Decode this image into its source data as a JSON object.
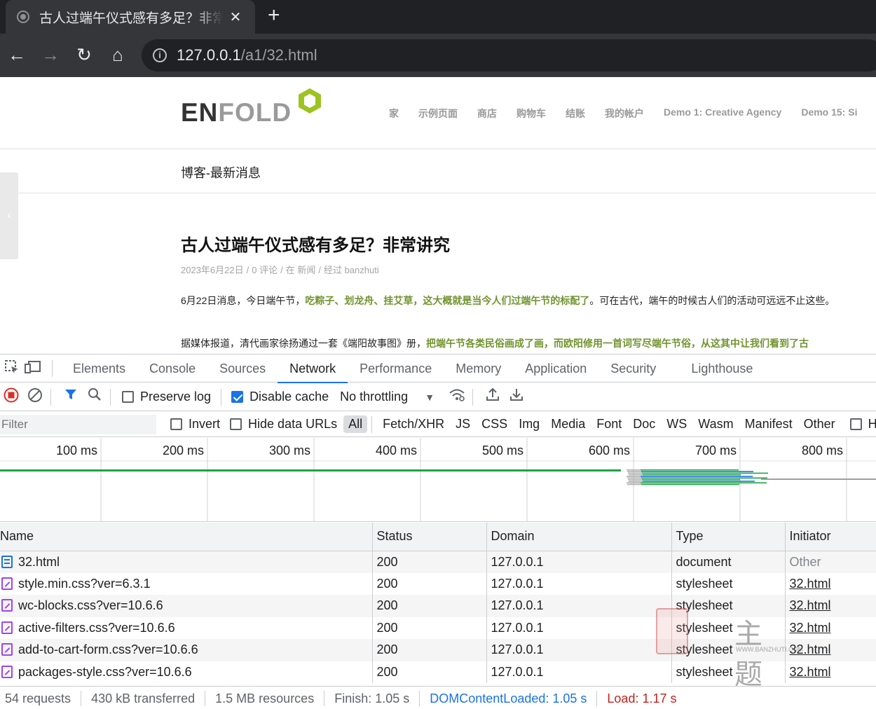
{
  "browser": {
    "tab_title": "古人过端午仪式感有多足？非常讲",
    "tab_close": "✕",
    "new_tab": "+",
    "url_host": "127.0.0.1",
    "url_path": "/a1/32.html",
    "nav": {
      "back": "←",
      "forward": "→",
      "reload": "↻",
      "home": "⌂",
      "info": "i"
    }
  },
  "site": {
    "logo_en": "EN",
    "logo_fold": "FOLD",
    "nav_items": [
      "家",
      "示例页面",
      "商店",
      "购物车",
      "结账",
      "我的帐户",
      "Demo 1: Creative Agency",
      "Demo 15: Si"
    ],
    "crumb_title": "博客-最新消息",
    "side_tab_arrow": "‹",
    "post": {
      "title": "古人过端午仪式感有多足？非常讲究",
      "meta": [
        "2023年6月22日",
        "0 评论",
        "在 新闻",
        "经过 banzhuti"
      ],
      "meta_sep": "/",
      "p1_a": "6月22日消息，今日端午节，",
      "p1_hl": "吃粽子、划龙舟、挂艾草，这大概就是当今人们过端午节的标配了",
      "p1_b": "。可在古代，端午的时候古人们的活动可远远不止这些。",
      "p2_a": "据媒体报道，清代画家徐扬通过一套《端阳故事图》册，",
      "p2_hl": "把端午节各类民俗画成了画，而欧阳修用一首词写尽端午节俗，从这其中让我们看到了古"
    }
  },
  "devtools": {
    "panel_tabs": [
      "Elements",
      "Console",
      "Sources",
      "Network",
      "Performance",
      "Memory",
      "Application",
      "Security",
      "Lighthouse"
    ],
    "active_tab": "Network",
    "toolbar": {
      "preserve_log": "Preserve log",
      "preserve_log_checked": false,
      "disable_cache": "Disable cache",
      "disable_cache_checked": true,
      "throttling": "No throttling"
    },
    "filter": {
      "placeholder": "Filter",
      "invert": "Invert",
      "hide_data_urls": "Hide data URLs",
      "types": [
        "All",
        "Fetch/XHR",
        "JS",
        "CSS",
        "Img",
        "Media",
        "Font",
        "Doc",
        "WS",
        "Wasm",
        "Manifest",
        "Other"
      ],
      "active_type": "All",
      "has_blocked": "Has"
    },
    "timeline_ticks": [
      "100 ms",
      "200 ms",
      "300 ms",
      "400 ms",
      "500 ms",
      "600 ms",
      "700 ms",
      "800 ms"
    ],
    "columns": [
      "Name",
      "Status",
      "Domain",
      "Type",
      "Initiator"
    ],
    "requests": [
      {
        "name": "32.html",
        "status": "200",
        "domain": "127.0.0.1",
        "type": "document",
        "initiator": "Other",
        "kind": "doc"
      },
      {
        "name": "style.min.css?ver=6.3.1",
        "status": "200",
        "domain": "127.0.0.1",
        "type": "stylesheet",
        "initiator": "32.html",
        "kind": "css"
      },
      {
        "name": "wc-blocks.css?ver=10.6.6",
        "status": "200",
        "domain": "127.0.0.1",
        "type": "stylesheet",
        "initiator": "32.html",
        "kind": "css"
      },
      {
        "name": "active-filters.css?ver=10.6.6",
        "status": "200",
        "domain": "127.0.0.1",
        "type": "stylesheet",
        "initiator": "32.html",
        "kind": "css"
      },
      {
        "name": "add-to-cart-form.css?ver=10.6.6",
        "status": "200",
        "domain": "127.0.0.1",
        "type": "stylesheet",
        "initiator": "32.html",
        "kind": "css"
      },
      {
        "name": "packages-style.css?ver=10.6.6",
        "status": "200",
        "domain": "127.0.0.1",
        "type": "stylesheet",
        "initiator": "32.html",
        "kind": "css"
      }
    ],
    "summary": {
      "requests": "54 requests",
      "transferred": "430 kB transferred",
      "resources": "1.5 MB resources",
      "finish": "Finish: 1.05 s",
      "dom_content_loaded": "DOMContentLoaded: 1.05 s",
      "load": "Load: 1.17 s"
    }
  },
  "watermark": {
    "chars": "主题",
    "url": "WWW.BANZHUTI.COM"
  },
  "colors": {
    "accent": "#1a73e8",
    "record": "#d93025",
    "brand_green": "#719430",
    "logo_hex": "#9cc420"
  }
}
